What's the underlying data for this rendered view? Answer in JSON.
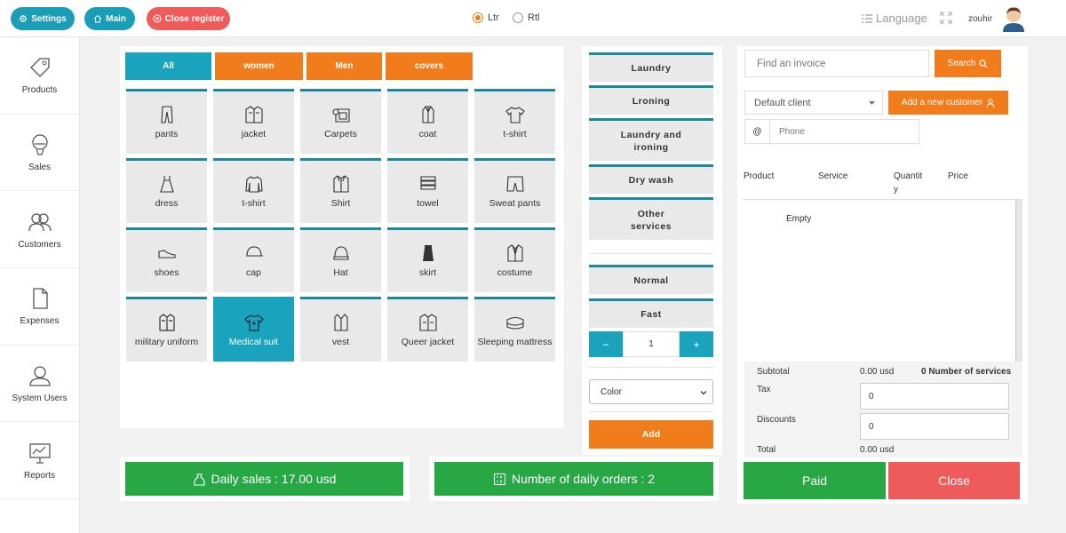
{
  "topbar": {
    "settings_label": "Settings",
    "main_label": "Main",
    "close_register_label": "Close register",
    "direction_options": [
      {
        "label": "Ltr",
        "selected": true
      },
      {
        "label": "Rtl",
        "selected": false
      }
    ],
    "language_label": "Language",
    "username": "zouhir"
  },
  "sidebar": {
    "items": [
      {
        "label": "Products",
        "icon": "tag-icon"
      },
      {
        "label": "Sales",
        "icon": "balloon-icon"
      },
      {
        "label": "Customers",
        "icon": "users-icon"
      },
      {
        "label": "Expenses",
        "icon": "document-icon"
      },
      {
        "label": "System Users",
        "icon": "user-icon"
      },
      {
        "label": "Reports",
        "icon": "monitor-chart-icon"
      }
    ]
  },
  "categories": {
    "tabs": [
      {
        "label": "All",
        "active": true
      },
      {
        "label": "women",
        "active": false
      },
      {
        "label": "Men",
        "active": false
      },
      {
        "label": "covers",
        "active": false
      }
    ]
  },
  "products": [
    {
      "label": "pants",
      "icon": "pants-icon"
    },
    {
      "label": "jacket",
      "icon": "jacket-icon"
    },
    {
      "label": "Carpets",
      "icon": "carpet-icon"
    },
    {
      "label": "coat",
      "icon": "coat-icon"
    },
    {
      "label": "t-shirt",
      "icon": "tshirt-icon"
    },
    {
      "label": "dress",
      "icon": "dress-icon"
    },
    {
      "label": "t-shirt",
      "icon": "long-sleeve-icon"
    },
    {
      "label": "Shirt",
      "icon": "shirt-icon"
    },
    {
      "label": "towel",
      "icon": "towel-icon"
    },
    {
      "label": "Sweat pants",
      "icon": "shorts-icon"
    },
    {
      "label": "shoes",
      "icon": "shoe-icon"
    },
    {
      "label": "cap",
      "icon": "cap-icon"
    },
    {
      "label": "Hat",
      "icon": "hat-icon"
    },
    {
      "label": "skirt",
      "icon": "skirt-icon"
    },
    {
      "label": "costume",
      "icon": "suit-icon"
    },
    {
      "label": "military uniform",
      "icon": "uniform-icon"
    },
    {
      "label": "Medical suit",
      "icon": "scrubs-icon",
      "active": true
    },
    {
      "label": "vest",
      "icon": "vest-icon"
    },
    {
      "label": "Queer jacket",
      "icon": "jacket-icon"
    },
    {
      "label": "Sleeping mattress",
      "icon": "mattress-icon"
    }
  ],
  "services": {
    "items": [
      "Laundry",
      "Lroning",
      "Laundry and ironing",
      "Dry wash",
      "Other services"
    ],
    "speed": [
      "Normal",
      "Fast"
    ],
    "quantity": {
      "minus": "−",
      "value": "1",
      "plus": "+"
    },
    "color_select": "Color",
    "add_label": "Add"
  },
  "invoice": {
    "search_placeholder": "Find an invoice",
    "search_label": "Search",
    "client_select": "Default client",
    "add_customer_label": "Add a new customer",
    "phone_prefix": "@",
    "phone_placeholder": "Phone",
    "columns": [
      "Product",
      "Service",
      "Quantity",
      "Price"
    ],
    "empty_text": "Empty",
    "subtotal_label": "Subtotal",
    "subtotal_value": "0.00 usd",
    "services_count": "0 Number of services",
    "tax_label": "Tax",
    "tax_value": "0",
    "discounts_label": "Discounts",
    "discounts_value": "0",
    "total_label": "Total",
    "total_value": "0.00 usd",
    "paid_label": "Paid",
    "close_label": "Close"
  },
  "stats": {
    "daily_sales": "Daily sales : 17.00 usd",
    "daily_orders": "Number of daily orders : 2"
  },
  "colors": {
    "teal": "#1a9eb8",
    "orange": "#f07c1c",
    "red": "#ef5b5b",
    "green": "#28a745"
  }
}
